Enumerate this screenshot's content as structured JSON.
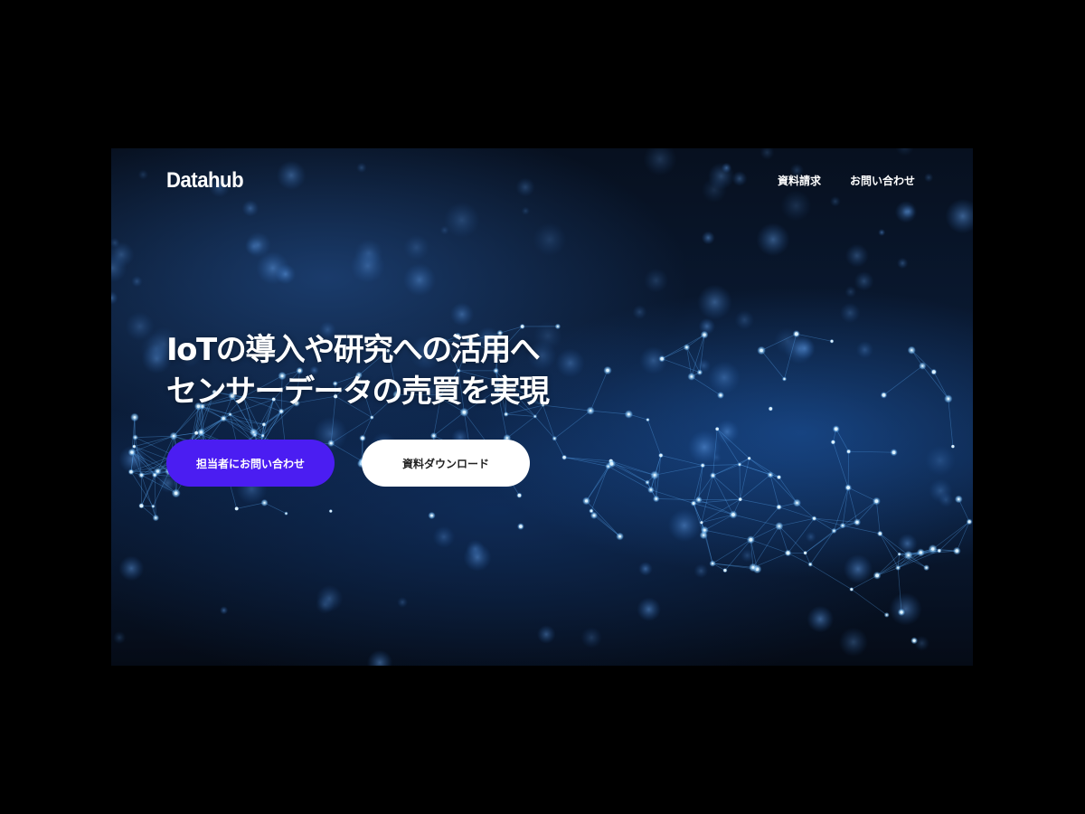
{
  "header": {
    "logo": "Datahub",
    "nav": [
      {
        "label": "資料請求"
      },
      {
        "label": "お問い合わせ"
      }
    ]
  },
  "hero": {
    "headline_line1": "IoTの導入や研究への活用へ",
    "headline_line2": "センサーデータの売買を実現",
    "primary_cta": "担当者にお問い合わせ",
    "secondary_cta": "資料ダウンロード"
  },
  "colors": {
    "primary_button": "#4b1df2",
    "secondary_button": "#ffffff",
    "page_background": "#000000"
  }
}
